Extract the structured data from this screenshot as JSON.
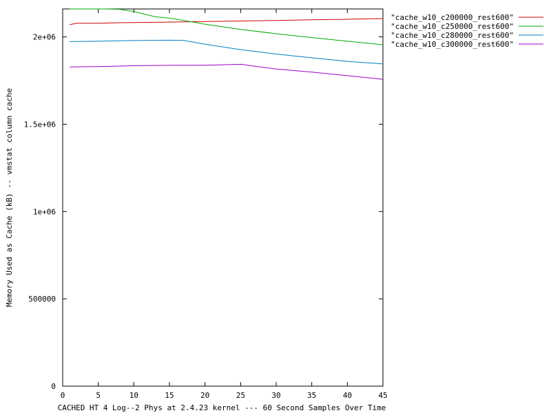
{
  "chart_data": {
    "type": "line",
    "xlabel": "CACHED HT 4 Log--2 Phys at 2.4.23 kernel --- 60 Second Samples Over Time",
    "ylabel": "Memory Used as Cache (kB) -- vmstat column cache",
    "xlim": [
      0,
      45
    ],
    "ylim": [
      0,
      2160000
    ],
    "xticks": [
      0,
      5,
      10,
      15,
      20,
      25,
      30,
      35,
      40,
      45
    ],
    "yticks": [
      0,
      500000,
      1000000,
      1500000,
      2000000
    ],
    "xtick_labels": [
      "0",
      "5",
      "10",
      "15",
      "20",
      "25",
      "30",
      "35",
      "40",
      "45"
    ],
    "ytick_labels": [
      "0",
      "500000",
      "1e+06",
      "1.5e+06",
      "2e+06"
    ],
    "grid": false,
    "legend_position": "top-right-outside",
    "series": [
      {
        "name": "\"cache_w10_c200000_rest600\"",
        "color": "#cc0000",
        "points": [
          [
            1,
            2070000
          ],
          [
            2,
            2078000
          ],
          [
            5,
            2078000
          ],
          [
            8,
            2081000
          ],
          [
            12,
            2083000
          ],
          [
            17,
            2086000
          ],
          [
            25,
            2091000
          ],
          [
            30,
            2094000
          ],
          [
            35,
            2098000
          ],
          [
            40,
            2101000
          ],
          [
            45,
            2105000
          ]
        ]
      },
      {
        "name": "\"cache_w10_c250000_rest600\"",
        "color": "#00aa00",
        "points": [
          [
            1,
            2160000
          ],
          [
            4,
            2160000
          ],
          [
            6,
            2162000
          ],
          [
            8,
            2158000
          ],
          [
            10,
            2145000
          ],
          [
            13,
            2115000
          ],
          [
            15,
            2108000
          ],
          [
            17,
            2094000
          ],
          [
            20,
            2073000
          ],
          [
            25,
            2043000
          ],
          [
            30,
            2018000
          ],
          [
            35,
            1996000
          ],
          [
            40,
            1975000
          ],
          [
            45,
            1955000
          ]
        ]
      },
      {
        "name": "\"cache_w10_c280000_rest600\"",
        "color": "#0080c0",
        "points": [
          [
            1,
            1973000
          ],
          [
            5,
            1975000
          ],
          [
            10,
            1979000
          ],
          [
            15,
            1981000
          ],
          [
            17,
            1980000
          ],
          [
            20,
            1958000
          ],
          [
            25,
            1927000
          ],
          [
            30,
            1902000
          ],
          [
            35,
            1880000
          ],
          [
            40,
            1860000
          ],
          [
            45,
            1845000
          ]
        ]
      },
      {
        "name": "\"cache_w10_c300000_rest600\"",
        "color": "#a000c8",
        "points": [
          [
            1,
            1828000
          ],
          [
            5,
            1830000
          ],
          [
            10,
            1835000
          ],
          [
            15,
            1837000
          ],
          [
            20,
            1838000
          ],
          [
            22,
            1840000
          ],
          [
            25,
            1843000
          ],
          [
            30,
            1816000
          ],
          [
            35,
            1798000
          ],
          [
            40,
            1778000
          ],
          [
            45,
            1757000
          ]
        ]
      }
    ]
  }
}
